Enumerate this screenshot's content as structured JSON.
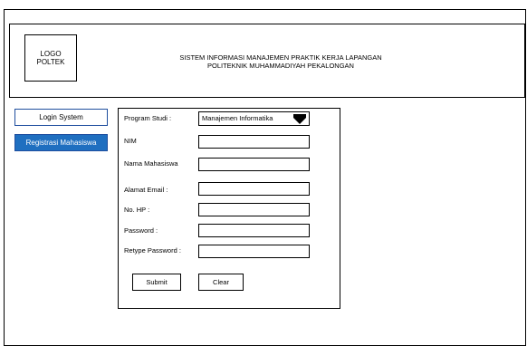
{
  "header": {
    "logo_line1": "LOGO",
    "logo_line2": "POLTEK",
    "title_line1": "SISTEM INFORMASI MANAJEMEN PRAKTIK KERJA LAPANGAN",
    "title_line2": "POLITEKNIK MUHAMMADIYAH PEKALONGAN"
  },
  "sidebar": {
    "items": [
      {
        "label": "Login System"
      },
      {
        "label": "Registrasi Mahasiswa"
      }
    ]
  },
  "form": {
    "program_studi_label": "Program Studi :",
    "program_studi_value": "Manajemen Informatika",
    "nim_label": "NIM",
    "nama_label": "Nama Mahasiswa",
    "email_label": "Alamat Email :",
    "hp_label": "No. HP :",
    "password_label": "Password :",
    "retype_label": "Retype Password :",
    "submit_label": "Submit",
    "clear_label": "Clear"
  },
  "icons": {
    "dropdown": "chevron-down-icon"
  },
  "colors": {
    "active_nav_bg": "#1f6fc0",
    "nav_border": "#1f4e9e"
  }
}
